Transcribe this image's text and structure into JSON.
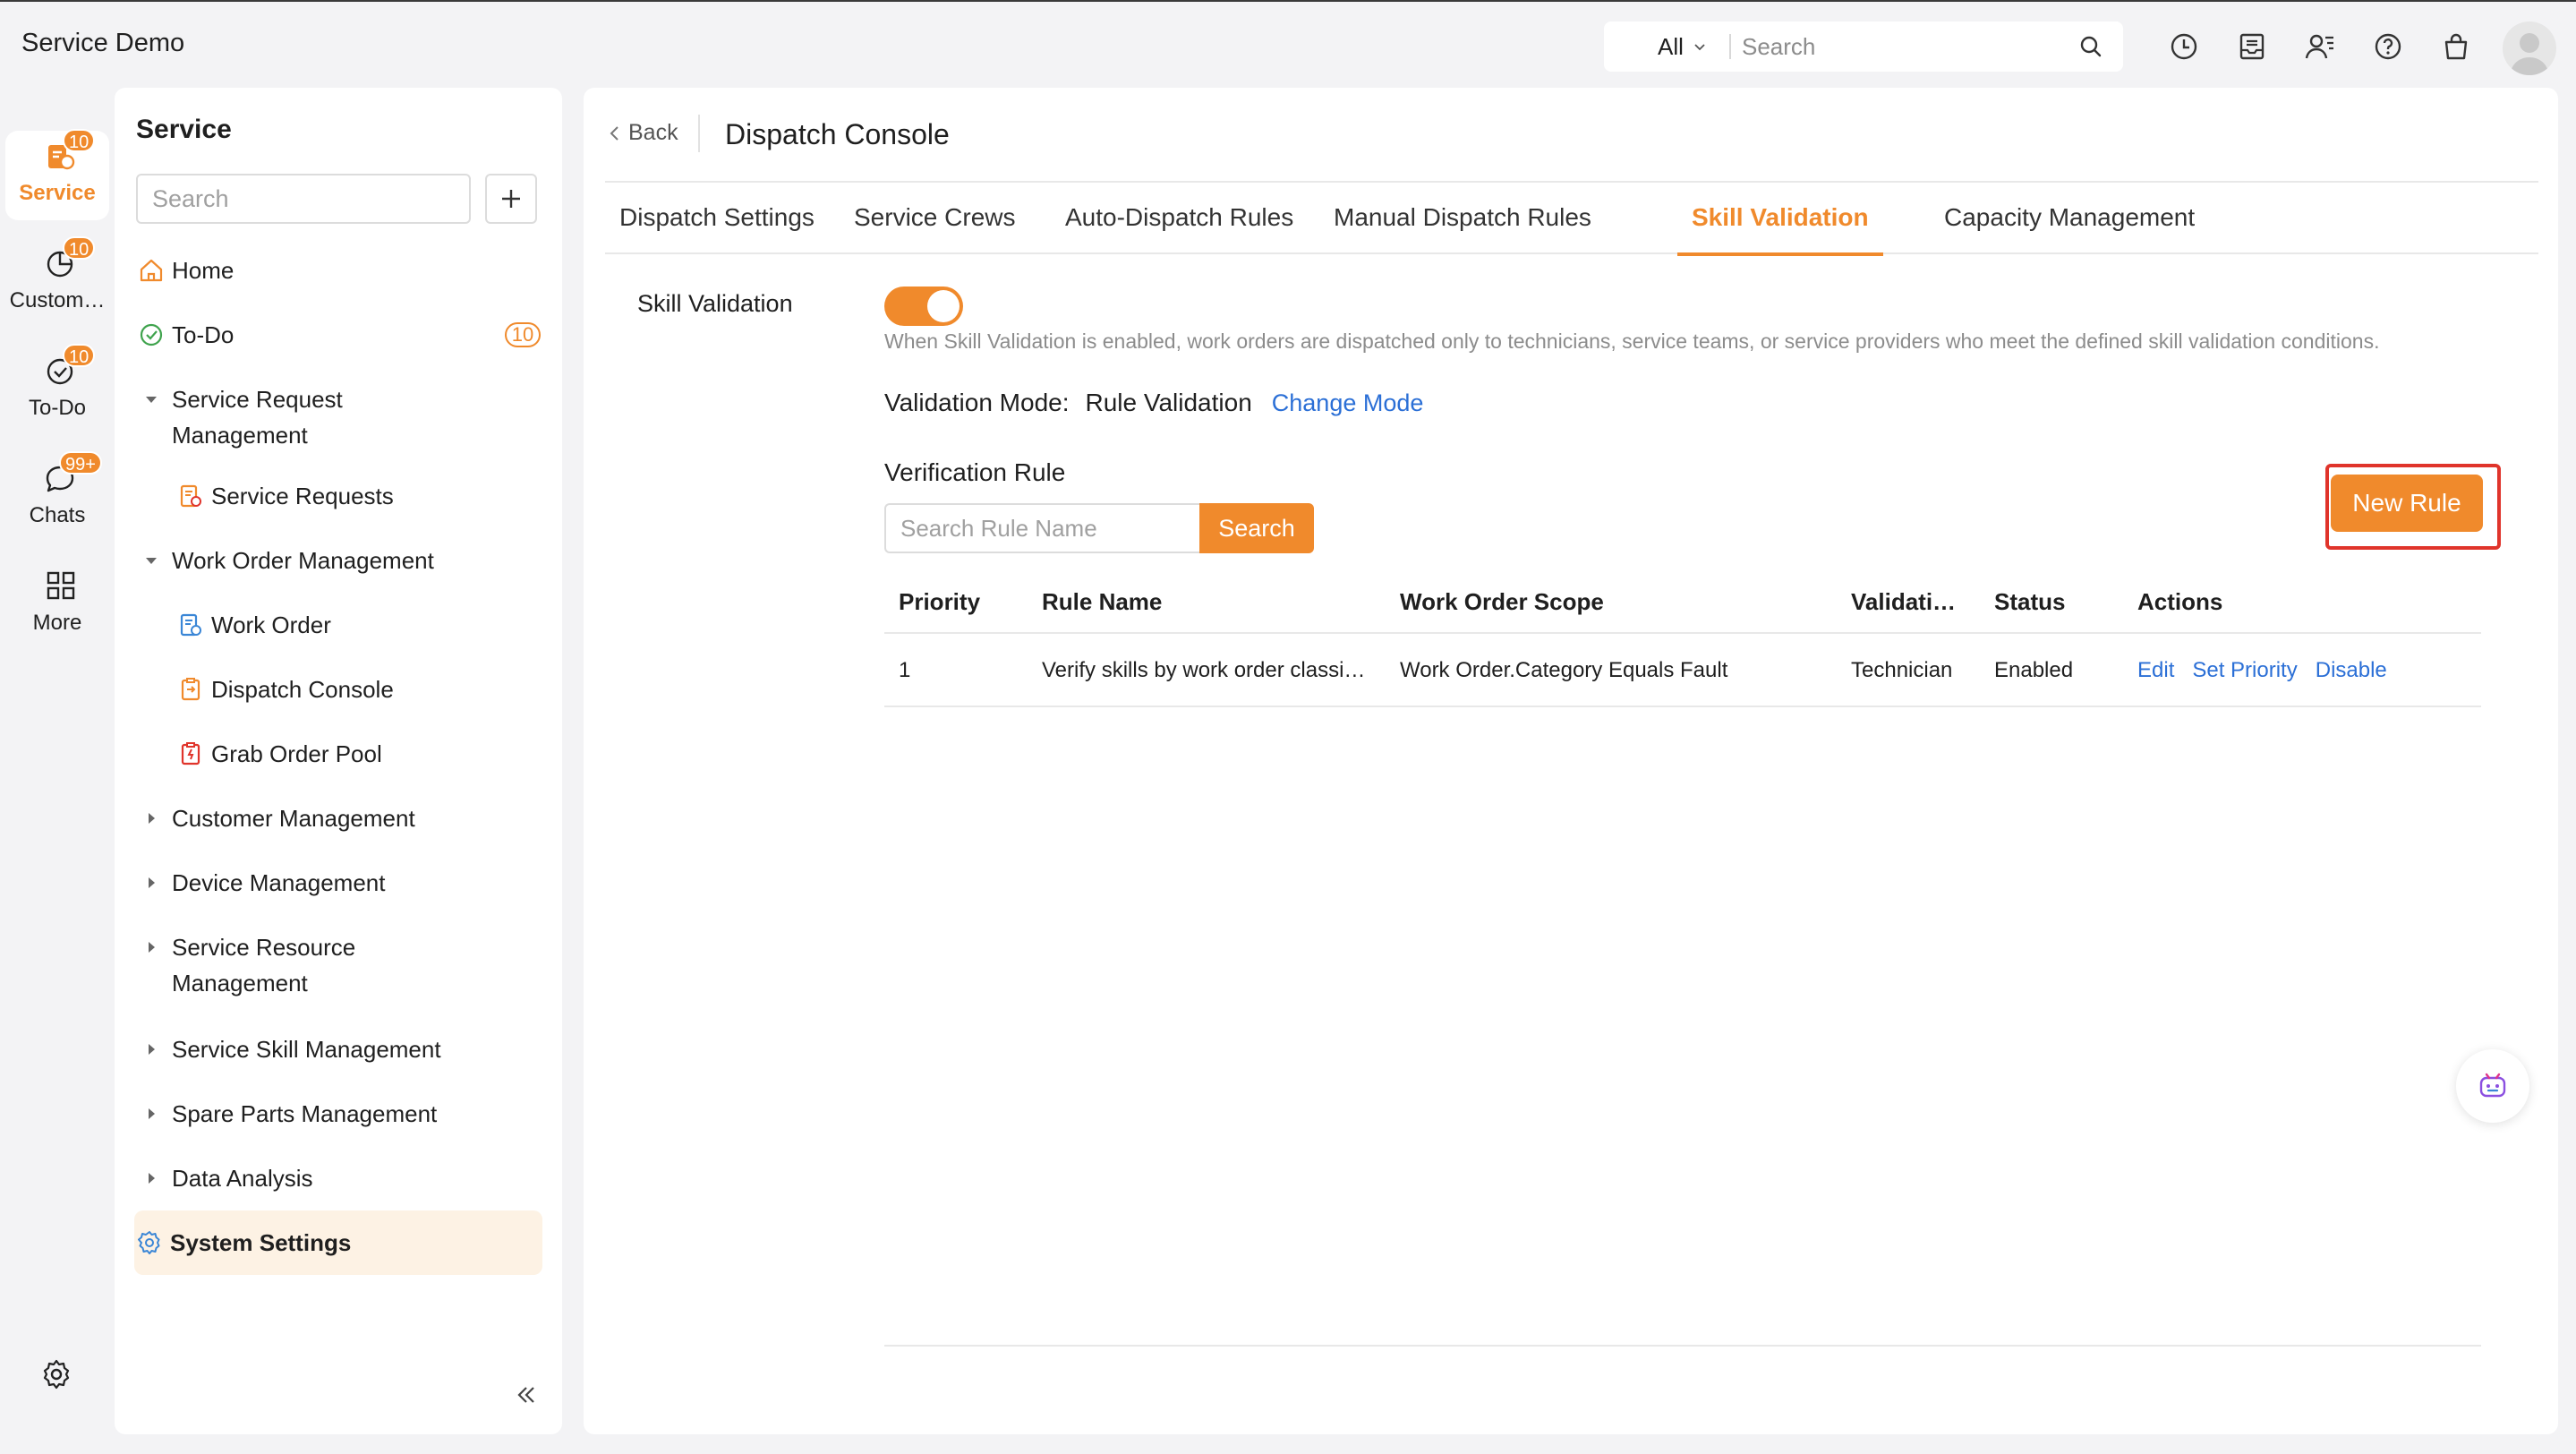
{
  "app": {
    "title": "Service Demo"
  },
  "topbar": {
    "scope": "All",
    "search_placeholder": "Search",
    "icons": [
      "clock-icon",
      "inbox-icon",
      "contacts-icon",
      "help-icon",
      "shop-icon",
      "avatar"
    ]
  },
  "rail": {
    "items": [
      {
        "label": "Service",
        "badge": "10",
        "icon": "service-icon",
        "active": true
      },
      {
        "label": "Custom…",
        "badge": "10",
        "icon": "pie-chart-icon"
      },
      {
        "label": "To-Do",
        "badge": "10",
        "icon": "check-circle-icon"
      },
      {
        "label": "Chats",
        "badge": "99+",
        "icon": "chat-bubble-icon"
      },
      {
        "label": "More",
        "icon": "grid-icon"
      }
    ]
  },
  "sidebar": {
    "title": "Service",
    "search_placeholder": "Search",
    "items": {
      "home": "Home",
      "todo": "To-Do",
      "todo_badge": "10",
      "srm_line1": "Service Request",
      "srm_line2": "Management",
      "service_requests": "Service Requests",
      "wom": "Work Order Management",
      "work_order": "Work Order",
      "dispatch_console": "Dispatch Console",
      "grab_order_pool": "Grab Order Pool",
      "customer_mgmt": "Customer Management",
      "device_mgmt": "Device Management",
      "srcm_line1": "Service Resource",
      "srcm_line2": "Management",
      "skill_mgmt": "Service Skill Management",
      "spare_parts": "Spare Parts Management",
      "data_analysis": "Data Analysis",
      "system_settings": "System Settings"
    }
  },
  "main": {
    "back": "Back",
    "title": "Dispatch Console",
    "tabs": [
      "Dispatch Settings",
      "Service Crews",
      "Auto-Dispatch Rules",
      "Manual Dispatch Rules",
      "Skill Validation",
      "Capacity Management"
    ],
    "active_tab": "Skill Validation",
    "skill_validation": {
      "label": "Skill Validation",
      "enabled": true,
      "description": "When Skill Validation is enabled, work orders are dispatched only to technicians, service teams, or service providers who meet the defined skill validation conditions."
    },
    "validation_mode": {
      "label": "Validation Mode:",
      "value": "Rule Validation",
      "change_link": "Change Mode"
    },
    "verification_rule": {
      "title": "Verification Rule",
      "search_placeholder": "Search Rule Name",
      "search_button": "Search",
      "new_rule_button": "New Rule"
    },
    "table": {
      "headers": [
        "Priority",
        "Rule Name",
        "Work Order Scope",
        "Validati…",
        "Status",
        "Actions"
      ],
      "rows": [
        {
          "priority": "1",
          "rule_name": "Verify skills by work order classi…",
          "scope": "Work Order.Category Equals Fault",
          "validation": "Technician",
          "status": "Enabled",
          "actions": [
            "Edit",
            "Set Priority",
            "Disable"
          ]
        }
      ]
    }
  },
  "colors": {
    "accent": "#f08a2c",
    "link": "#2b6fd6",
    "highlight_frame": "#e0342b"
  }
}
